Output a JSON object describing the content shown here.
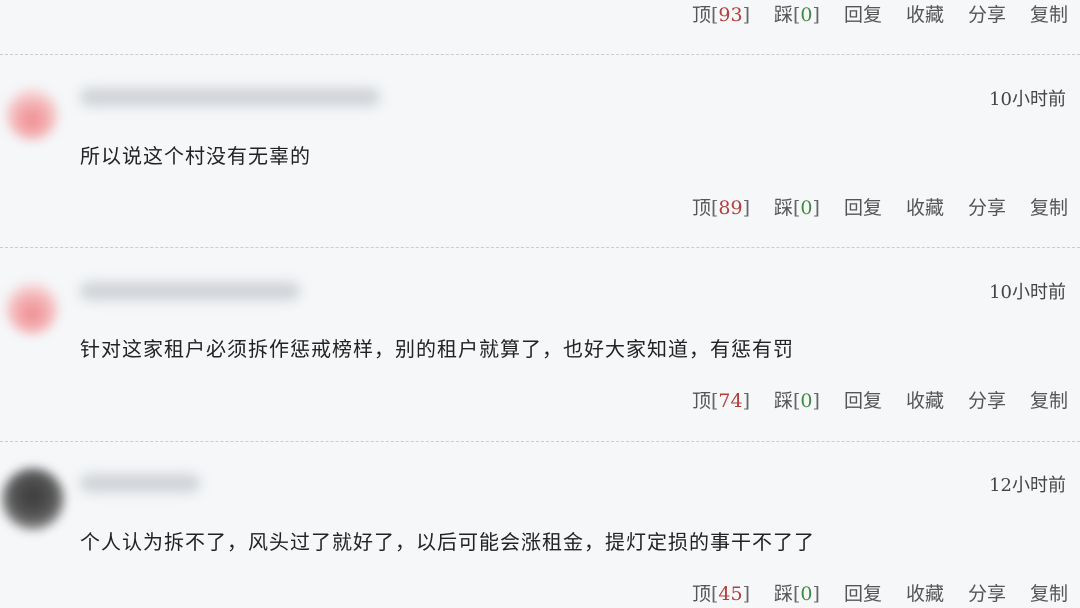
{
  "actions_labels": {
    "up_label": "顶",
    "down_label": "踩",
    "reply": "回复",
    "favorite": "收藏",
    "share": "分享",
    "copy": "复制"
  },
  "top_item": {
    "up_count": "93",
    "down_count": "0"
  },
  "comments": [
    {
      "time": "10小时前",
      "text": "所以说这个村没有无辜的",
      "up_count": "89",
      "down_count": "0"
    },
    {
      "time": "10小时前",
      "text": "针对这家租户必须拆作惩戒榜样，别的租户就算了，也好大家知道，有惩有罚",
      "up_count": "74",
      "down_count": "0"
    },
    {
      "time": "12小时前",
      "text": "个人认为拆不了，风头过了就好了，以后可能会涨租金，提灯定损的事干不了了",
      "up_count": "45",
      "down_count": "0"
    }
  ]
}
